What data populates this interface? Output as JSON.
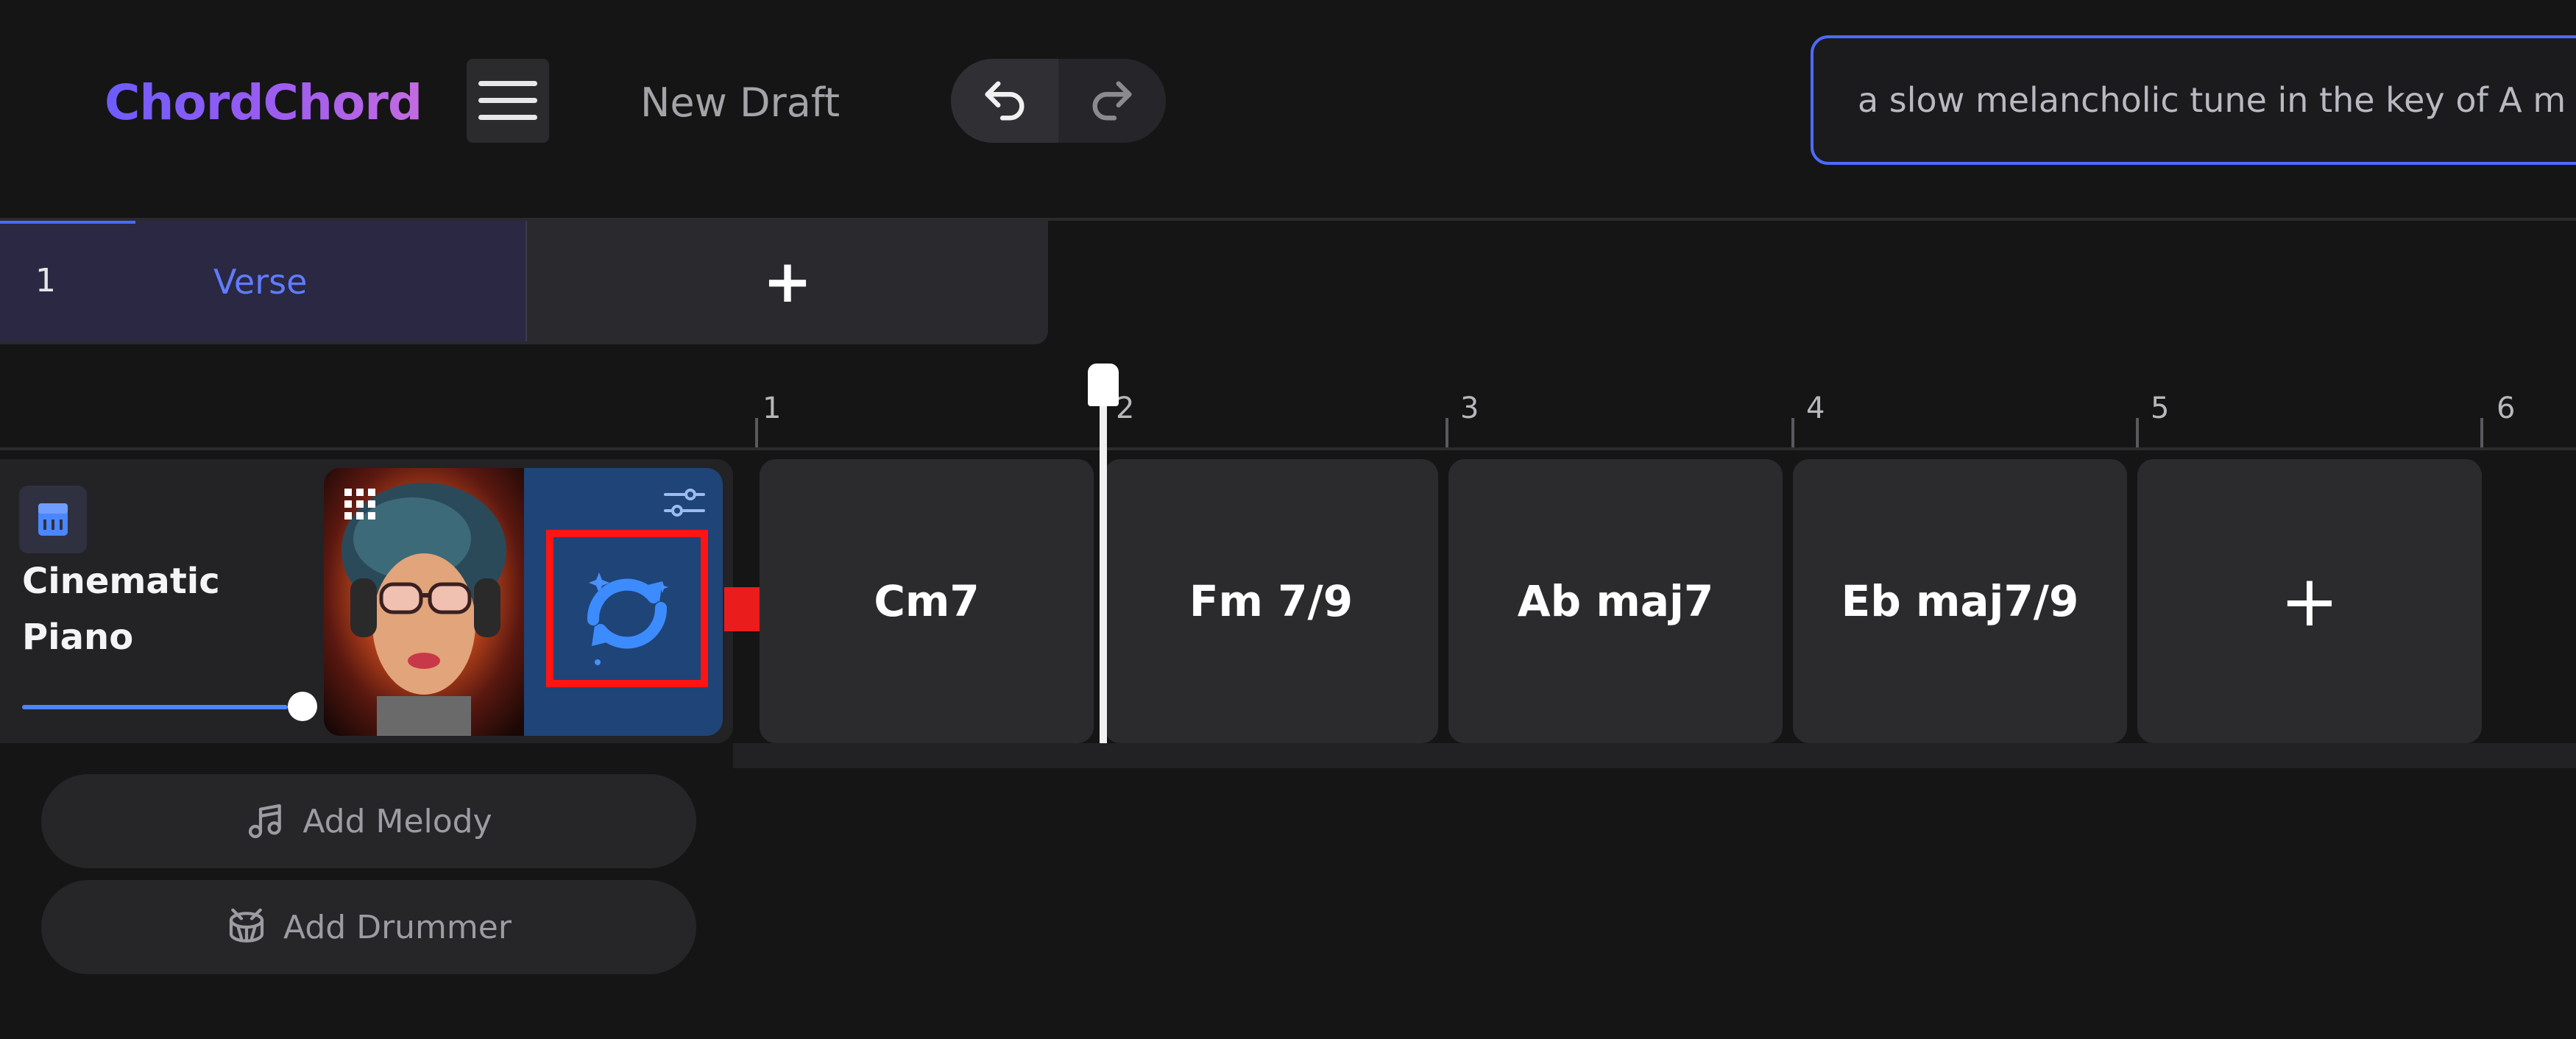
{
  "header": {
    "logo": "ChordChord",
    "draft_title": "New Draft",
    "prompt_value": "a slow melancholic tune in the key of A m"
  },
  "sections": {
    "tabs": [
      {
        "number": "1",
        "label": "Verse"
      }
    ],
    "add_label": "+"
  },
  "timeline": {
    "bars": [
      "1",
      "2",
      "3",
      "4",
      "5",
      "6"
    ]
  },
  "track": {
    "name": "Cinematic Piano",
    "volume": 0.92,
    "chords": [
      "Cm7",
      "Fm 7/9",
      "Ab maj7",
      "Eb maj7/9"
    ],
    "add_chord_label": "+"
  },
  "actions": {
    "add_melody": "Add Melody",
    "add_drummer": "Add Drummer"
  },
  "colors": {
    "accent": "#4d6bff",
    "highlight": "#ff1414",
    "regen_panel": "#1f4478"
  },
  "icons": [
    "menu-icon",
    "undo-icon",
    "redo-icon",
    "piano-icon",
    "grid-icon",
    "regenerate-icon",
    "settings-sliders-icon",
    "music-note-icon",
    "drum-icon"
  ]
}
